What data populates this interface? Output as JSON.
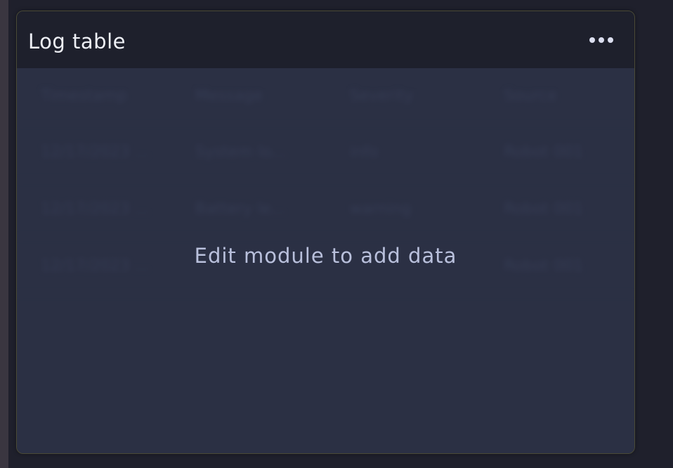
{
  "module": {
    "title": "Log table",
    "menu_icon": "more-horizontal-icon",
    "empty_message": "Edit module to add data"
  },
  "placeholder_table": {
    "headers": [
      "Timestamp",
      "Message",
      "Severity",
      "Source"
    ],
    "rows": [
      [
        "12/17/2023 ...",
        "System lo...",
        "info",
        "Robot 001"
      ],
      [
        "12/17/2023 ...",
        "Battery le...",
        "warning",
        "Robot 001"
      ],
      [
        "12/17/2023 ...",
        "",
        "",
        "Robot 001"
      ]
    ]
  },
  "colors": {
    "page_background": "#1f202c",
    "header_background": "#1e202c",
    "card_background": "#2b3044",
    "card_border": "#4a4a36",
    "text_primary": "#eef0f6",
    "text_muted": "#b9c0dc"
  }
}
